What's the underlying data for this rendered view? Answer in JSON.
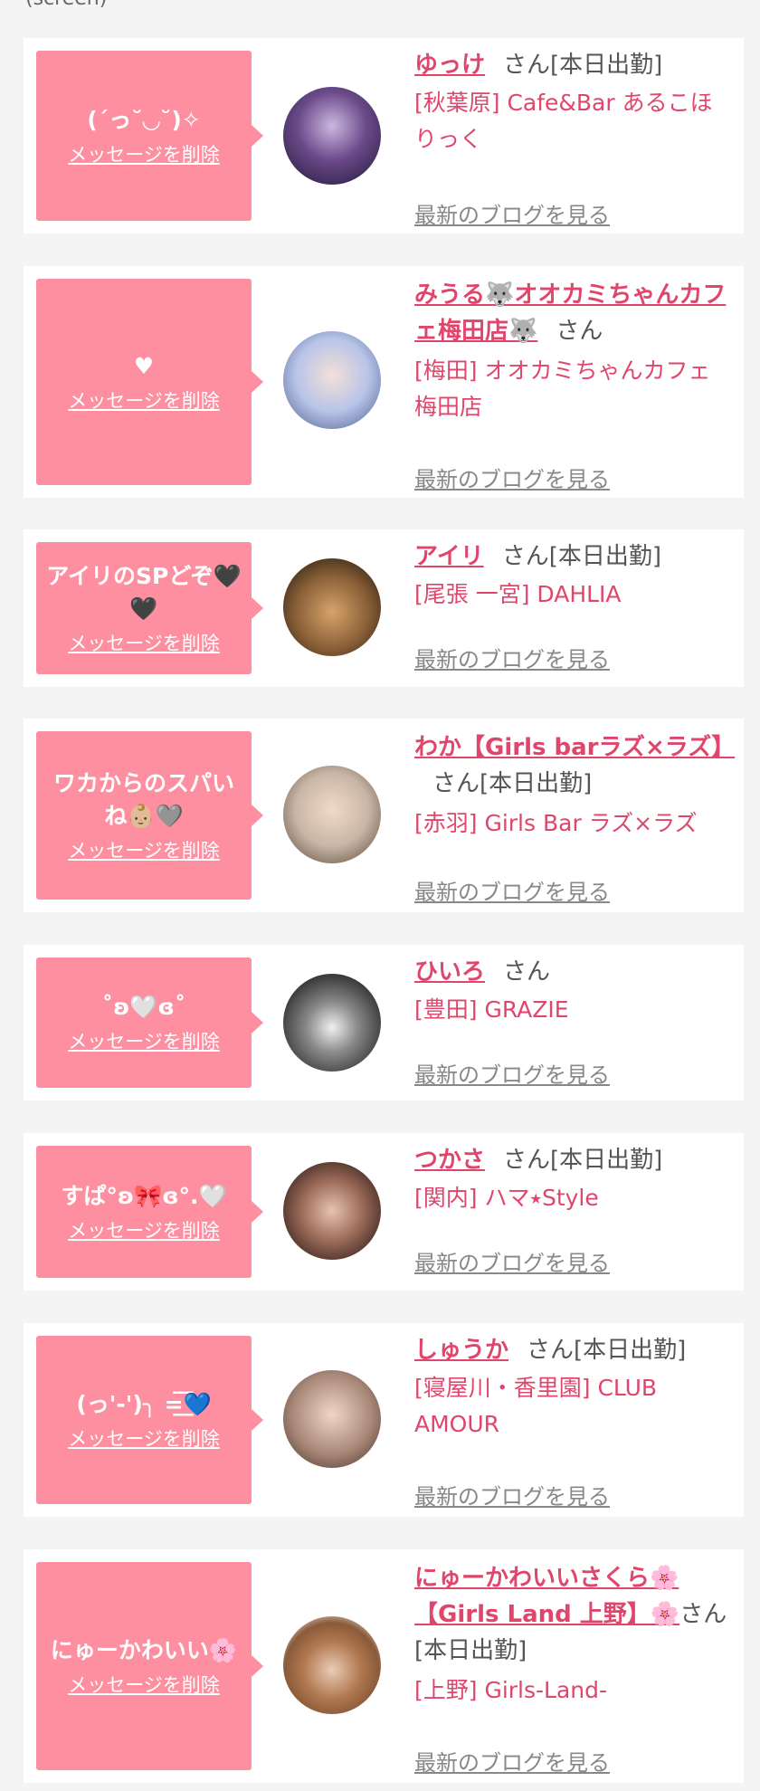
{
  "header_partial": {
    "left": "(screen)"
  },
  "cards": [
    {
      "message": "(´っ˘◡˘)✧",
      "delete_label": "メッセージを削除",
      "name": "ゆっけ",
      "suffix": "さん[本日出勤]",
      "shop": "[秋葉原] Cafe&Bar あるこほりっく",
      "blog_link": "最新のブログを見る",
      "avatar_colors": [
        "#3a2a55",
        "#cbb8e0"
      ]
    },
    {
      "message": "♥",
      "delete_label": "メッセージを削除",
      "name": "みうる🐺オオカミちゃんカフェ梅田店🐺",
      "suffix": "さん",
      "shop": "[梅田] オオカミちゃんカフェ梅田店",
      "blog_link": "最新のブログを見る",
      "avatar_colors": [
        "#b8c4e8",
        "#f3e0d8"
      ]
    },
    {
      "message": "アイリのSPどぞ🖤🖤",
      "delete_label": "メッセージを削除",
      "name": "アイリ",
      "suffix": "さん[本日出勤]",
      "shop": "[尾張 一宮] DAHLIA",
      "blog_link": "最新のブログを見る",
      "avatar_colors": [
        "#6b4a2a",
        "#d7a36b"
      ]
    },
    {
      "message": "ワカからのスパいね👶🏼🩶",
      "delete_label": "メッセージを削除",
      "name": "わか【Girls barラズ×ラズ】",
      "suffix": "さん[本日出勤]",
      "shop": "[赤羽] Girls Bar ラズ×ラズ",
      "blog_link": "最新のブログを見る",
      "avatar_colors": [
        "#c8b7a6",
        "#f2d8c8"
      ]
    },
    {
      "message": "˚ʚ🤍ɞ˚",
      "delete_label": "メッセージを削除",
      "name": "ひいろ",
      "suffix": "さん",
      "shop": "[豊田] GRAZIE",
      "blog_link": "最新のブログを見る",
      "avatar_colors": [
        "#2a2a2a",
        "#8a8a8a"
      ]
    },
    {
      "message": "すぱ°ʚ🎀ɞ°.🤍",
      "delete_label": "メッセージを削除",
      "name": "つかさ",
      "suffix": "さん[本日出勤]",
      "shop": "[関内] ハマ⭑Style",
      "blog_link": "最新のブログを見る",
      "avatar_colors": [
        "#3b2420",
        "#e8c2b0"
      ]
    },
    {
      "message": "(っ'-')╮ =͟͟͞͞💙",
      "delete_label": "メッセージを削除",
      "name": "しゅうか",
      "suffix": "さん[本日出勤]",
      "shop": "[寝屋川・香里園] CLUB AMOUR",
      "blog_link": "最新のブログを見る",
      "avatar_colors": [
        "#a88878",
        "#f0d6c8"
      ]
    },
    {
      "message": "にゅーかわいい🌸",
      "delete_label": "メッセージを削除",
      "name": "にゅーかわいいさくら🌸【Girls Land 上野】🌸",
      "suffix": "さん[本日出勤]",
      "shop": "[上野] Girls-Land-",
      "blog_link": "最新のブログを見る",
      "avatar_colors": [
        "#8a5a3a",
        "#e9cdb6"
      ]
    }
  ]
}
